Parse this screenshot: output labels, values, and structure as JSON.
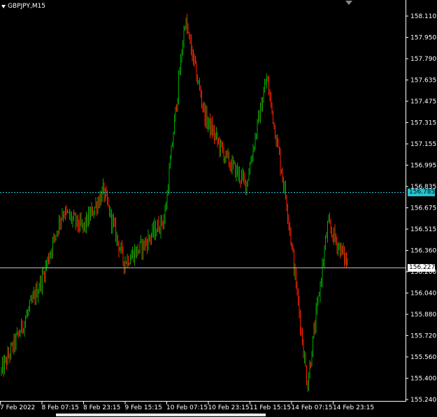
{
  "window": {
    "title": "GBPJPY,M15"
  },
  "price_axis": {
    "labels": [
      "158.110",
      "157.950",
      "157.790",
      "157.635",
      "157.475",
      "157.315",
      "157.155",
      "156.995",
      "156.835",
      "156.675",
      "156.515",
      "156.360",
      "156.200",
      "156.040",
      "155.880",
      "155.720",
      "155.560",
      "155.400",
      "155.240"
    ]
  },
  "time_axis": {
    "labels": [
      "7 Feb 2022",
      "8 Feb 07:15",
      "8 Feb 23:15",
      "9 Feb 15:15",
      "10 Feb 07:15",
      "10 Feb 23:15",
      "11 Feb 15:15",
      "14 Feb 07:15",
      "14 Feb 23:15"
    ]
  },
  "levels": {
    "alert_price": "156.785",
    "current_price": "156.227"
  },
  "colors": {
    "background": "#000000",
    "bull": "#00aa00",
    "bear": "#ff2200",
    "alert_line": "#22c4d2",
    "current_line": "#c0c0c0",
    "axis": "#ffffff"
  },
  "chart_data": {
    "type": "line",
    "symbol": "GBPJPY",
    "timeframe": "M15",
    "x": [
      "7 Feb 2022",
      "8 Feb 07:15",
      "8 Feb 23:15",
      "9 Feb 15:15",
      "10 Feb 07:15",
      "10 Feb 23:15",
      "11 Feb 15:15",
      "14 Feb 07:15",
      "14 Feb 23:15"
    ],
    "ylim": [
      155.24,
      158.11
    ],
    "series": [
      {
        "values": [
          155.45,
          155.78,
          156.15,
          156.65,
          156.52,
          156.8,
          156.27,
          156.4,
          156.6,
          158.08,
          157.35,
          157.05,
          156.85,
          157.65,
          156.7,
          155.35,
          156.55,
          156.25
        ]
      }
    ]
  }
}
